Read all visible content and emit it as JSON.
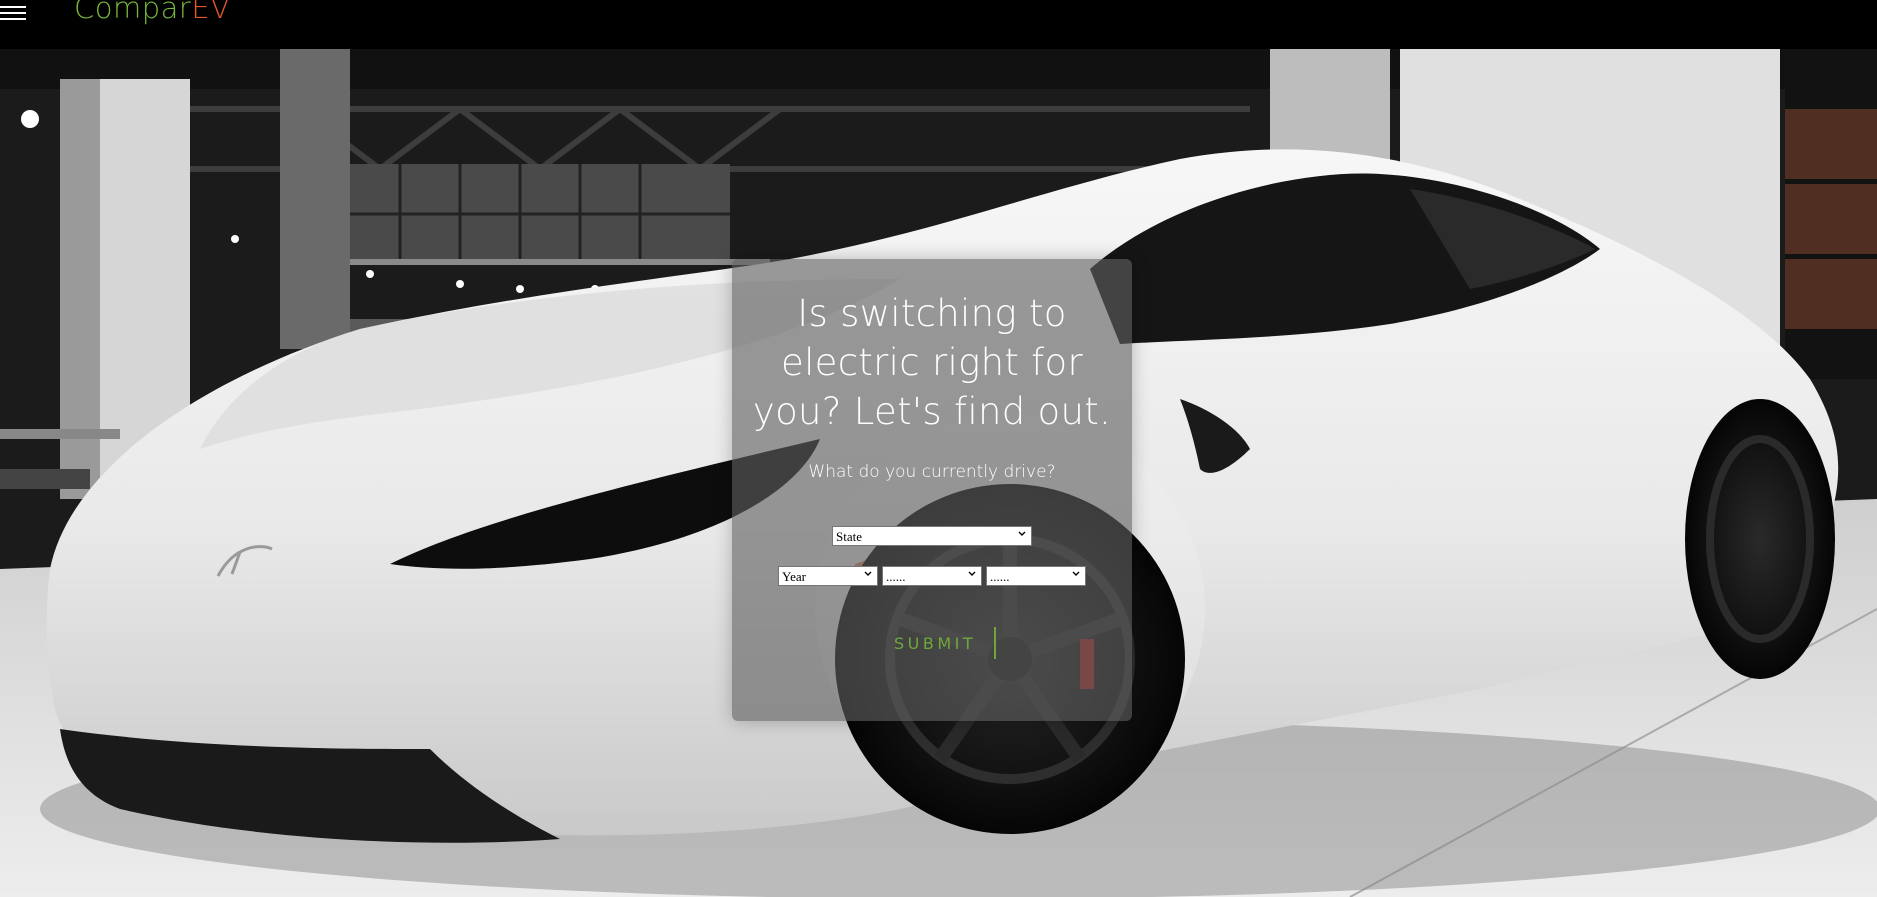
{
  "brand": {
    "name_part1": "Compar",
    "name_part2": "EV",
    "color_part1": "#78b83a",
    "color_part2": "#e4572a"
  },
  "nav": {
    "menu_icon": "hamburger-menu-icon"
  },
  "hero": {
    "headline": "Is switching to electric right for you? Let's find out.",
    "question": "What do you currently drive?",
    "background": "white electric sports car in dark showroom"
  },
  "form": {
    "state": {
      "selected": "State"
    },
    "year": {
      "selected": "Year"
    },
    "make": {
      "selected": "......"
    },
    "model": {
      "selected": "......"
    },
    "submit_label": "SUBMIT"
  }
}
